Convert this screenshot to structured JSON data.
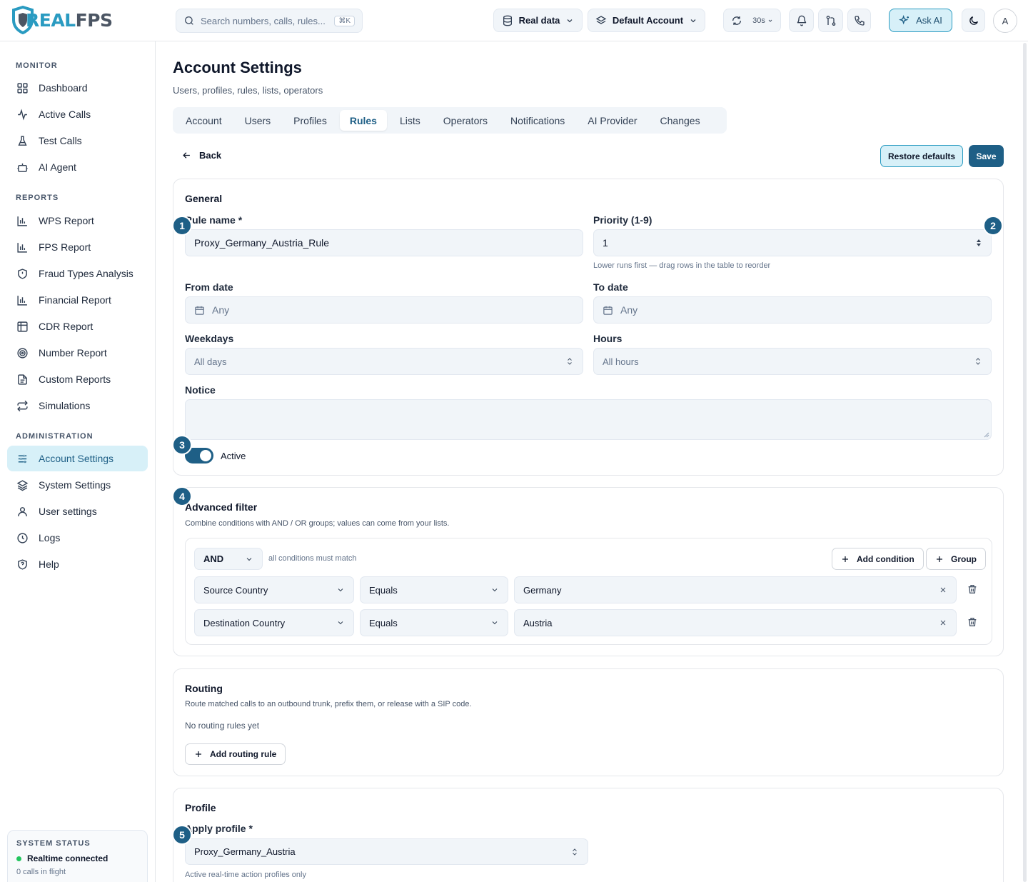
{
  "app": {
    "logo_prefix": "REAL",
    "logo_suffix": "FPS"
  },
  "topbar": {
    "search_placeholder": "Search numbers, calls, rules...",
    "search_shortcut": "⌘K",
    "data_source": "Real data",
    "account": "Default Account",
    "refresh_interval": "30s",
    "ask_ai": "Ask AI",
    "avatar_initial": "A"
  },
  "sidebar": {
    "sections": [
      "MONITOR",
      "REPORTS",
      "ADMINISTRATION"
    ],
    "monitor": [
      "Dashboard",
      "Active Calls",
      "Test Calls",
      "AI Agent"
    ],
    "reports": [
      "WPS Report",
      "FPS Report",
      "Fraud Types Analysis",
      "Financial Report",
      "CDR Report",
      "Number Report",
      "Custom Reports",
      "Simulations"
    ],
    "administration": [
      "Account Settings",
      "System Settings",
      "User settings",
      "Logs",
      "Help"
    ],
    "status": {
      "title": "SYSTEM STATUS",
      "connection": "Realtime connected",
      "calls": "0 calls in flight"
    }
  },
  "page": {
    "title": "Account Settings",
    "subtitle": "Users, profiles, rules, lists, operators",
    "tabs": [
      "Account",
      "Users",
      "Profiles",
      "Rules",
      "Lists",
      "Operators",
      "Notifications",
      "AI Provider",
      "Changes"
    ],
    "active_tab": "Rules",
    "back": "Back",
    "restore": "Restore defaults",
    "save": "Save"
  },
  "general": {
    "title": "General",
    "rule_name_label": "Rule name *",
    "rule_name_value": "Proxy_Germany_Austria_Rule",
    "priority_label": "Priority (1-9)",
    "priority_value": "1",
    "priority_help": "Lower runs first — drag rows in the table to reorder",
    "from_label": "From date",
    "from_value": "Any",
    "to_label": "To date",
    "to_value": "Any",
    "weekdays_label": "Weekdays",
    "weekdays_value": "All days",
    "hours_label": "Hours",
    "hours_value": "All hours",
    "notice_label": "Notice",
    "active_label": "Active",
    "active": true
  },
  "filter": {
    "title": "Advanced filter",
    "desc": "Combine conditions with AND / OR groups; values can come from your lists.",
    "operator": "AND",
    "operator_hint": "all conditions must match",
    "add_condition": "Add condition",
    "add_group": "Group",
    "conditions": [
      {
        "field": "Source Country",
        "op": "Equals",
        "value": "Germany"
      },
      {
        "field": "Destination Country",
        "op": "Equals",
        "value": "Austria"
      }
    ]
  },
  "routing": {
    "title": "Routing",
    "desc": "Route matched calls to an outbound trunk, prefix them, or release with a SIP code.",
    "empty": "No routing rules yet",
    "add": "Add routing rule"
  },
  "profile": {
    "title": "Profile",
    "label": "Apply profile *",
    "value": "Proxy_Germany_Austria",
    "help": "Active real-time action profiles only"
  },
  "badges": [
    "1",
    "2",
    "3",
    "4",
    "5"
  ],
  "colors": {
    "accent": "#1e5f86",
    "accent_light": "#d7f0f8",
    "logo_blue": "#2a9bc1",
    "status_ok": "#22c55e"
  }
}
